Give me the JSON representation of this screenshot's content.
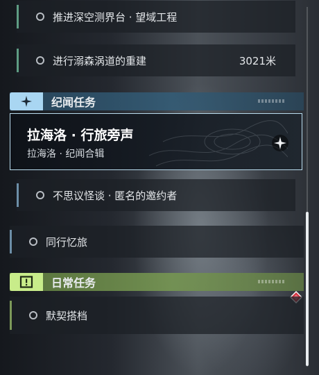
{
  "tasks_top": [
    {
      "label": "推进深空测界台 · 望域工程"
    },
    {
      "label": "进行溺森涡道的重建",
      "distance": "3021米"
    }
  ],
  "story_section": {
    "title": "纪闻任务",
    "accent": "#a9d6f2",
    "selected": {
      "title": "拉海洛 · 行旅旁声",
      "subtitle": "拉海洛 · 纪闻合辑"
    },
    "items": [
      {
        "label": "不思议怪谈 · 匿名的邀约者"
      },
      {
        "label": "同行忆旅"
      }
    ]
  },
  "daily_section": {
    "title": "日常任务",
    "accent": "#c8ec8a",
    "items": [
      {
        "label": "默契搭档"
      }
    ]
  },
  "icons": {
    "story": "four-point-star-icon",
    "daily": "exclamation-box-icon",
    "tracked": "compass-star-icon",
    "alert": "red-diamond-icon"
  }
}
